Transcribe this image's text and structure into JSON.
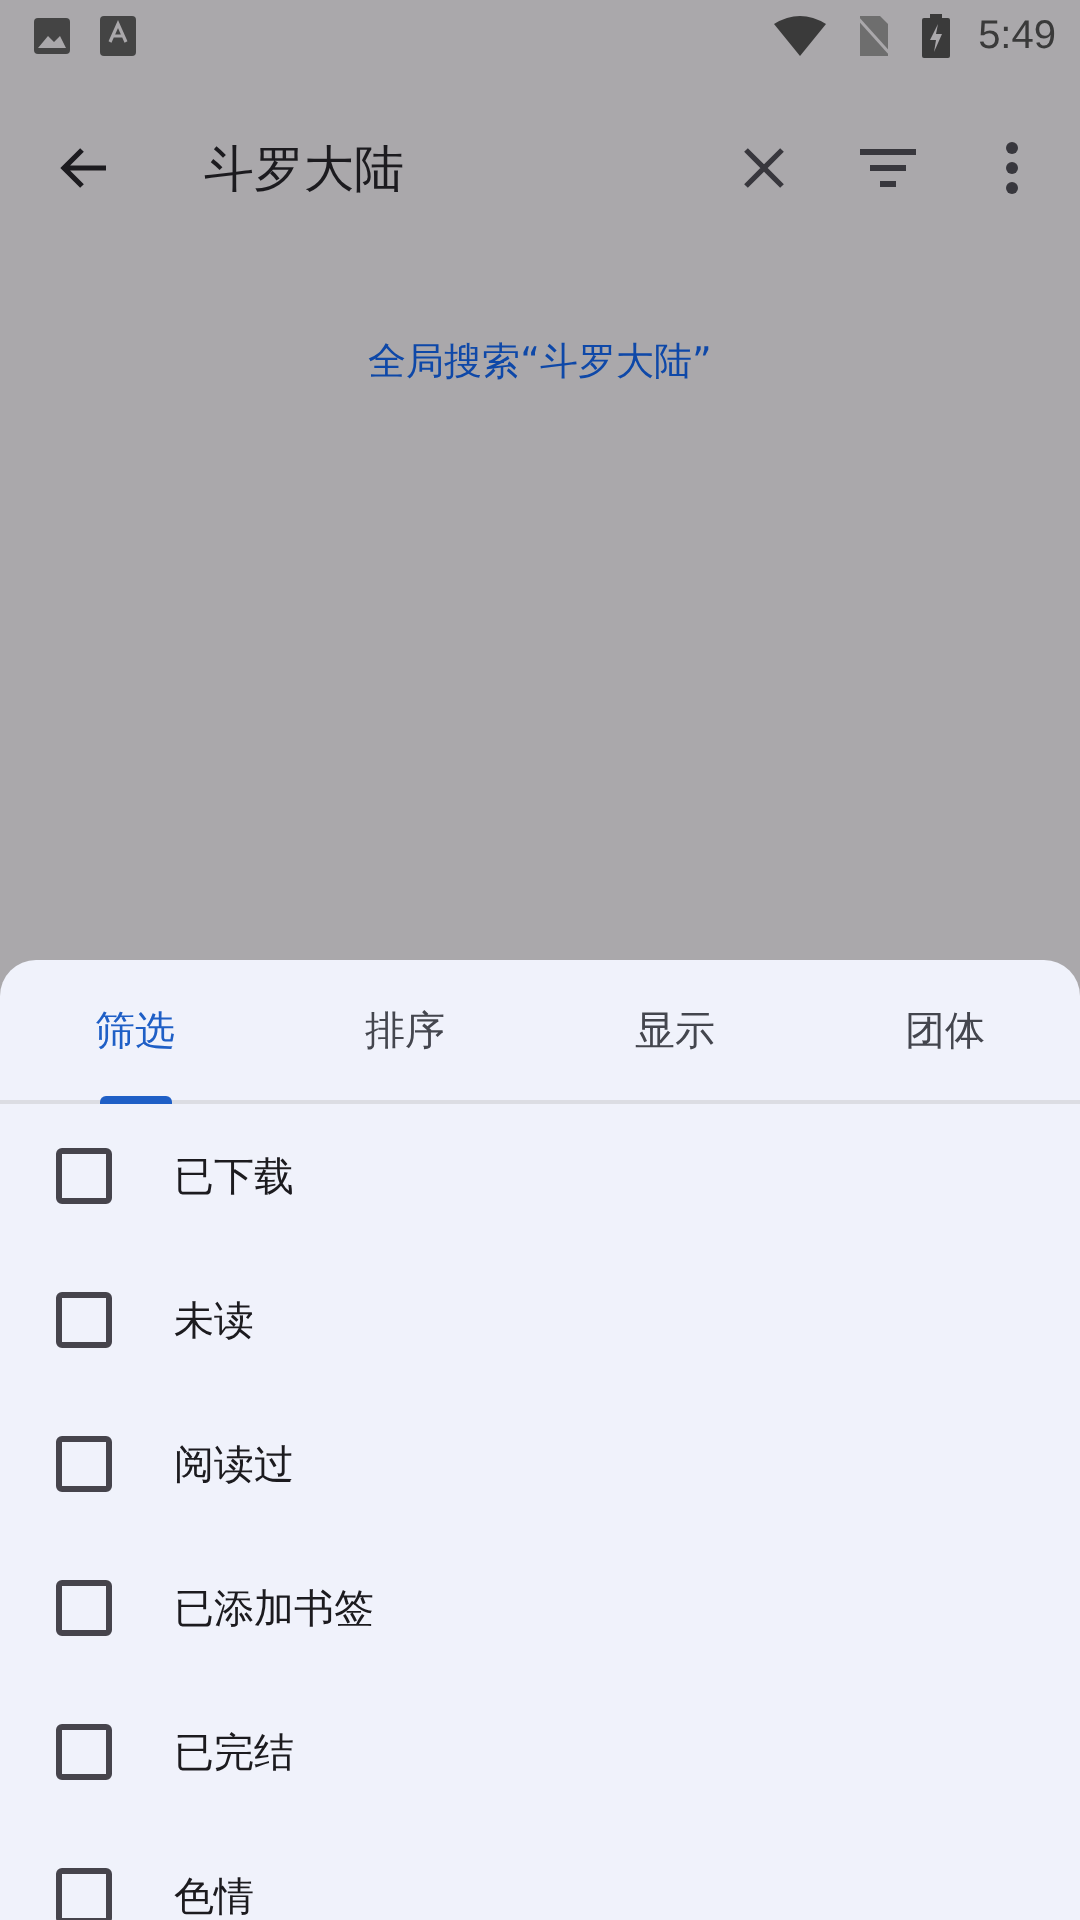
{
  "status_bar": {
    "time": "5:49"
  },
  "toolbar": {
    "query": "斗罗大陆"
  },
  "global_search_link": "全局搜索“斗罗大陆”",
  "sheet": {
    "tabs": [
      {
        "label": "筛选",
        "selected": true
      },
      {
        "label": "排序",
        "selected": false
      },
      {
        "label": "显示",
        "selected": false
      },
      {
        "label": "团体",
        "selected": false
      }
    ],
    "filters": [
      {
        "label": "已下载",
        "checked": false
      },
      {
        "label": "未读",
        "checked": false
      },
      {
        "label": "阅读过",
        "checked": false
      },
      {
        "label": "已添加书签",
        "checked": false
      },
      {
        "label": "已完结",
        "checked": false
      },
      {
        "label": "色情",
        "checked": false
      }
    ]
  }
}
